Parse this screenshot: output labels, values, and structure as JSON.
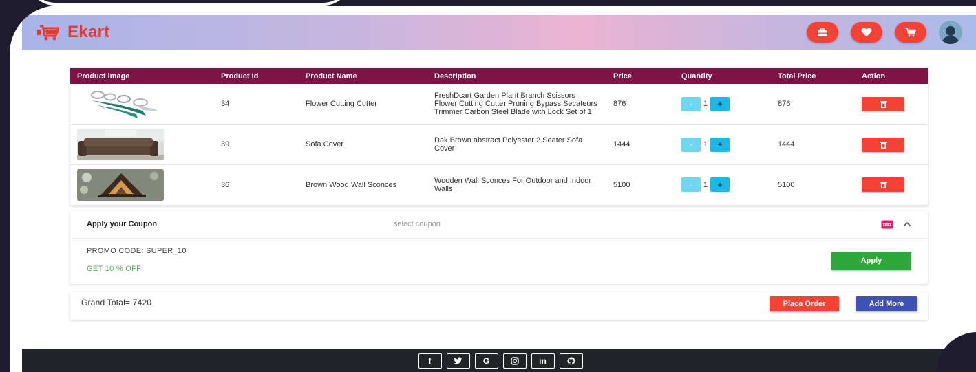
{
  "brand": {
    "name": "Ekart",
    "color": "#e53935"
  },
  "navbar": {
    "icons": [
      "briefcase-icon",
      "heart-icon",
      "cart-icon",
      "user-avatar-icon"
    ],
    "icon_bg": "#f44336"
  },
  "cart_table": {
    "headers": [
      "Product image",
      "Product Id",
      "Product Name",
      "Description",
      "Price",
      "Quantity",
      "Total Price",
      "Action"
    ],
    "header_bg": "#7d1445",
    "rows": [
      {
        "image": "garden-pruning-shears",
        "id": "34",
        "name": "Flower Cutting Cutter",
        "description": "FreshDcart Garden Plant Branch Scissors Flower Cutting Cutter Pruning Bypass Secateurs Trimmer Carbon Steel Blade with Lock Set of 1",
        "price": "876",
        "quantity": "1",
        "total": "876"
      },
      {
        "image": "brown-sofa",
        "id": "39",
        "name": "Sofa Cover",
        "description": "Dak Brown abstract Polyester 2 Seater Sofa Cover",
        "price": "1444",
        "quantity": "1",
        "total": "1444"
      },
      {
        "image": "wooden-wall-sconce",
        "id": "36",
        "name": "Brown Wood Wall Sconces",
        "description": "Wooden Wall Sconces For Outdoor and Indoor Walls",
        "price": "5100",
        "quantity": "1",
        "total": "5100"
      }
    ],
    "qty_minus": "-",
    "qty_plus": "+"
  },
  "coupon": {
    "title": "Apply your Coupon",
    "select_placeholder": "select coupon",
    "promo_code": "PROMO CODE: SUPER_10",
    "offer": "GET 10 % OFF",
    "apply_label": "Apply",
    "offer_color": "#4caf50"
  },
  "summary": {
    "grand_total": "Grand Total= 7420",
    "place_order_label": "Place Order",
    "add_more_label": "Add More"
  },
  "footer": {
    "social": [
      {
        "name": "facebook-icon",
        "glyph": "f"
      },
      {
        "name": "twitter-icon",
        "glyph": ""
      },
      {
        "name": "google-icon",
        "glyph": "G"
      },
      {
        "name": "instagram-icon",
        "glyph": ""
      },
      {
        "name": "linkedin-icon",
        "glyph": "in"
      },
      {
        "name": "github-icon",
        "glyph": ""
      }
    ]
  }
}
